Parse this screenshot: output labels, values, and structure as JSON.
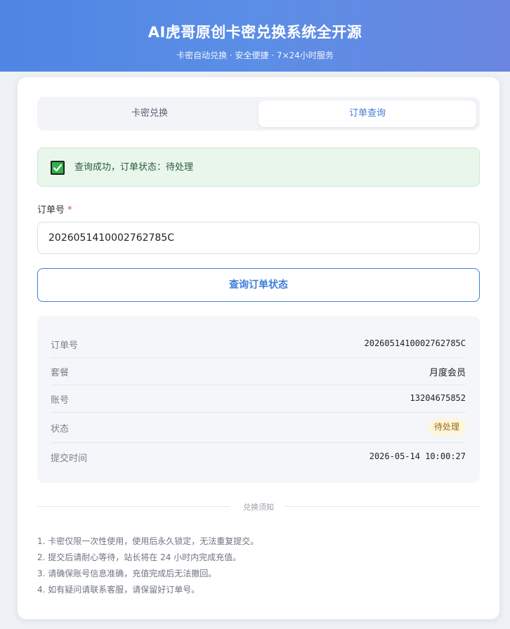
{
  "header": {
    "title": "AI虎哥原创卡密兑换系统全开源",
    "subtitle": "卡密自动兑换 · 安全便捷 · 7×24小时服务"
  },
  "tabs": [
    {
      "label": "卡密兑换",
      "active": false
    },
    {
      "label": "订单查询",
      "active": true
    }
  ],
  "alert": {
    "icon": "check-icon",
    "message": "查询成功，订单状态：待处理",
    "color": "#2fb24a"
  },
  "form": {
    "order_label": "订单号",
    "required_mark": "*",
    "order_value": "2026051410002762785C",
    "submit_label": "查询订单状态"
  },
  "result": {
    "rows": [
      {
        "key": "订单号",
        "value": "2026051410002762785C"
      },
      {
        "key": "套餐",
        "value": "月度会员"
      },
      {
        "key": "账号",
        "value": "13204675852"
      },
      {
        "key": "状态",
        "value": "待处理"
      },
      {
        "key": "提交时间",
        "value": "2026-05-14 10:00:27"
      }
    ]
  },
  "notes": {
    "title": "兑换须知",
    "items": [
      "1. 卡密仅限一次性使用，使用后永久锁定，无法重复提交。",
      "2. 提交后请耐心等待，站长将在 24 小时内完成充值。",
      "3. 请确保账号信息准确，充值完成后无法撤回。",
      "4. 如有疑问请联系客服，请保留好订单号。"
    ]
  },
  "colors": {
    "accent": "#3f7fd9",
    "header_gradient_start": "#4f86e3",
    "success_bg": "#e8f6ec",
    "status_badge_bg": "#fdf6dc"
  }
}
